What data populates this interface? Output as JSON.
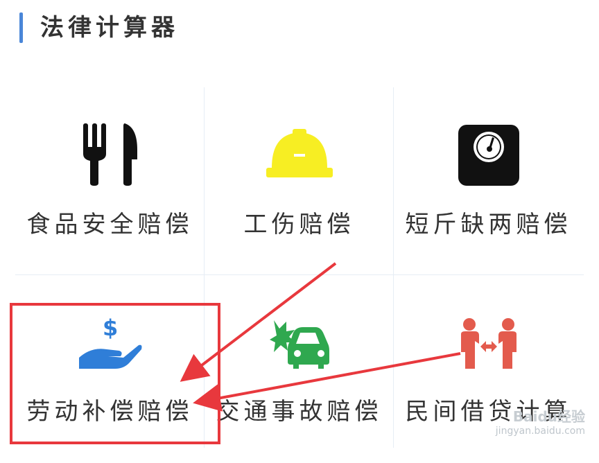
{
  "header": {
    "title": "法律计算器"
  },
  "tiles": [
    {
      "label": "食品安全赔偿",
      "icon": "fork-knife-icon",
      "color": "#111111"
    },
    {
      "label": "工伤赔偿",
      "icon": "hard-hat-icon",
      "color": "#f7ee23"
    },
    {
      "label": "短斤缺两赔偿",
      "icon": "scale-icon",
      "color": "#111111"
    },
    {
      "label": "劳动补偿赔偿",
      "icon": "hand-dollar-icon",
      "color": "#2f7ed8"
    },
    {
      "label": "交通事故赔偿",
      "icon": "car-crash-icon",
      "color": "#2fa84f"
    },
    {
      "label": "民间借贷计算",
      "icon": "people-exchange-icon",
      "color": "#e35b4d"
    }
  ],
  "annotation": {
    "highlight_color": "#e8383d",
    "arrow_color": "#e8383d"
  },
  "watermark": {
    "brand": "Baidu经验",
    "url": "jingyan.baidu.com"
  }
}
